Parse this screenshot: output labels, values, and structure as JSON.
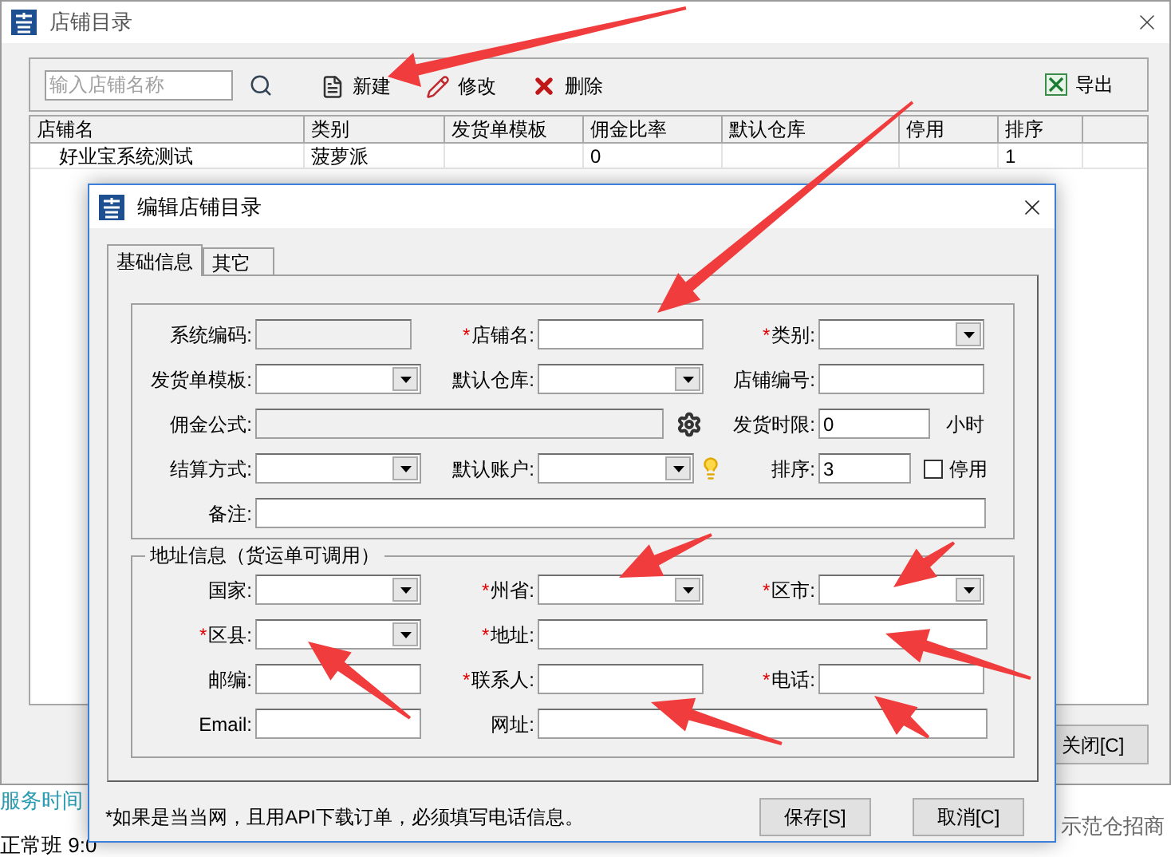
{
  "window": {
    "title": "店铺目录"
  },
  "toolbar": {
    "search": {
      "placeholder": "输入店铺名称"
    },
    "buttons": [
      {
        "label": "新建",
        "kind": "new"
      },
      {
        "label": "修改",
        "kind": "edit"
      },
      {
        "label": "删除",
        "kind": "delete"
      }
    ],
    "export": {
      "label": "导出"
    }
  },
  "table": {
    "columns": [
      "店铺名",
      "类别",
      "发货单模板",
      "佣金比率",
      "默认仓库",
      "停用",
      "排序"
    ],
    "rows": [
      [
        "好业宝系统测试",
        "菠萝派",
        "",
        "0",
        "",
        "",
        "1"
      ]
    ]
  },
  "close_button": {
    "label": "关闭[C]"
  },
  "background_page": {
    "left_texts": [
      "服务时间",
      "正常班 9:0"
    ],
    "right_text": "示范仓招商"
  },
  "dialog": {
    "title": "编辑店铺目录",
    "tabs": [
      {
        "label": "基础信息",
        "selected": true
      },
      {
        "label": "其它",
        "selected": false
      }
    ],
    "basic": {
      "rows": [
        [
          {
            "label": "系统编码:",
            "kind": "readonly"
          },
          {
            "mark": "*",
            "label": "店铺名:",
            "kind": "text"
          },
          {
            "mark": "*",
            "label": "类别:",
            "kind": "select"
          }
        ],
        [
          {
            "label": "发货单模板:",
            "kind": "select"
          },
          {
            "label": "默认仓库:",
            "kind": "select"
          },
          {
            "label": "店铺编号:",
            "kind": "text"
          }
        ],
        [
          {
            "label": "佣金公式:",
            "kind": "formula"
          },
          "",
          {
            "label": "发货时限:",
            "kind": "hours",
            "value": "0",
            "unit": "小时"
          }
        ],
        [
          {
            "label": "结算方式:",
            "kind": "select"
          },
          {
            "label": "默认账户:",
            "kind": "select-hint"
          },
          {
            "label": "排序:",
            "kind": "order",
            "value": "3",
            "toggle": {
              "label": "停用",
              "checked": false
            }
          }
        ],
        [
          {
            "label": "备注:",
            "kind": "remark"
          }
        ]
      ]
    },
    "address": {
      "legend": "地址信息（货运单可调用）",
      "rows": [
        [
          {
            "label": "国家:",
            "kind": "select"
          },
          {
            "mark": "*",
            "label": "州省:",
            "kind": "select"
          },
          {
            "mark": "*",
            "label": "区市:",
            "kind": "select"
          }
        ],
        [
          {
            "mark": "*",
            "label": "区县:",
            "kind": "select"
          },
          {
            "mark": "*",
            "label": "地址:",
            "kind": "wide"
          }
        ],
        [
          {
            "label": "邮编:",
            "kind": "text"
          },
          {
            "mark": "*",
            "label": "联系人:",
            "kind": "text"
          },
          {
            "mark": "*",
            "label": "电话:",
            "kind": "text"
          }
        ],
        [
          {
            "label": "Email:",
            "kind": "text"
          },
          {
            "label": "网址:",
            "kind": "wide"
          }
        ]
      ]
    },
    "note": "*如果是当当网，且用API下载订单，必须填写电话信息。",
    "buttons": [
      {
        "label": "保存[S]"
      },
      {
        "label": "取消[C]"
      }
    ]
  }
}
